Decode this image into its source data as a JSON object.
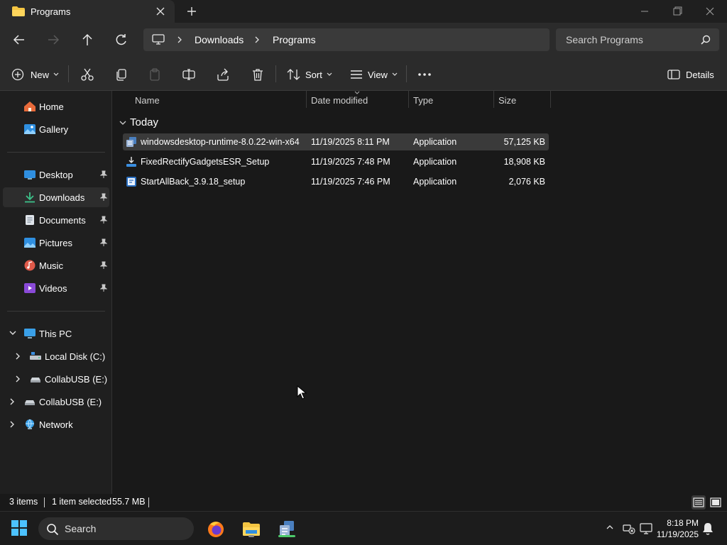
{
  "window": {
    "tab_title": "Programs"
  },
  "address_bar": {
    "breadcrumbs": [
      "Downloads",
      "Programs"
    ],
    "search_placeholder": "Search Programs"
  },
  "command_bar": {
    "new_label": "New",
    "sort_label": "Sort",
    "view_label": "View",
    "details_label": "Details"
  },
  "sidebar": {
    "quick": [
      {
        "label": "Home",
        "icon": "home-icon"
      },
      {
        "label": "Gallery",
        "icon": "gallery-icon"
      }
    ],
    "pinned": [
      {
        "label": "Desktop",
        "icon": "desktop-icon"
      },
      {
        "label": "Downloads",
        "icon": "downloads-icon",
        "selected": true
      },
      {
        "label": "Documents",
        "icon": "documents-icon"
      },
      {
        "label": "Pictures",
        "icon": "pictures-icon"
      },
      {
        "label": "Music",
        "icon": "music-icon"
      },
      {
        "label": "Videos",
        "icon": "videos-icon"
      }
    ],
    "tree": [
      {
        "label": "This PC",
        "expanded": true
      },
      {
        "label": "Local Disk (C:)"
      },
      {
        "label": "CollabUSB (E:)"
      },
      {
        "label": "CollabUSB (E:)"
      },
      {
        "label": "Network"
      }
    ]
  },
  "file_list": {
    "columns": [
      "Name",
      "Date modified",
      "Type",
      "Size"
    ],
    "group": "Today",
    "rows": [
      {
        "name": "windowsdesktop-runtime-8.0.22-win-x64",
        "date": "11/19/2025 8:11 PM",
        "type": "Application",
        "size": "57,125 KB",
        "selected": true
      },
      {
        "name": "FixedRectifyGadgetsESR_Setup",
        "date": "11/19/2025 7:48 PM",
        "type": "Application",
        "size": "18,908 KB"
      },
      {
        "name": "StartAllBack_3.9.18_setup",
        "date": "11/19/2025 7:46 PM",
        "type": "Application",
        "size": "2,076 KB"
      }
    ]
  },
  "status_bar": {
    "item_count": "3 items",
    "selection": "1 item selected",
    "selection_size": "55.7 MB"
  },
  "taskbar": {
    "search_label": "Search",
    "time": "8:18 PM",
    "date": "11/19/2025"
  },
  "colors": {
    "folder": "#f4c542",
    "accent": "#4cc2ff",
    "selected_row": "#3a3a3a"
  }
}
